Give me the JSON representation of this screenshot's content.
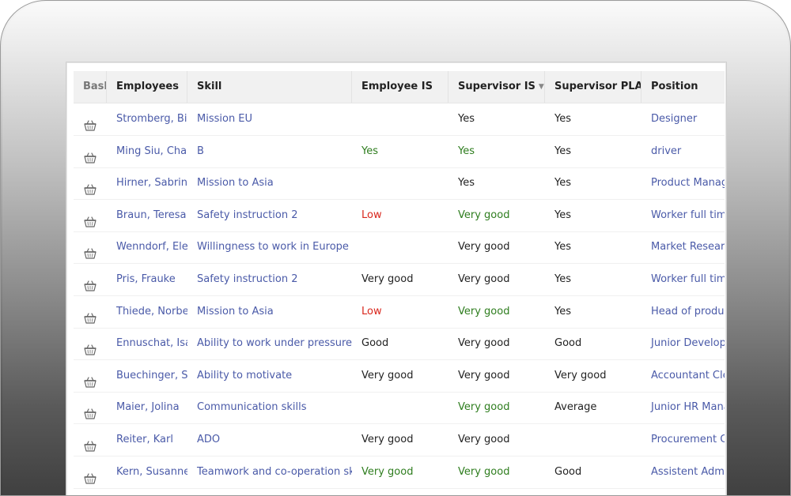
{
  "columns": {
    "basket": "Basket",
    "employees": "Employees",
    "skill": "Skill",
    "employee_is": "Employee IS",
    "supervisor_is": "Supervisor IS",
    "supervisor_plan": "Supervisor PLAN",
    "position": "Position"
  },
  "sort": {
    "column": "supervisor_is",
    "direction": "descending",
    "icon": "sort-down-triangle-icon"
  },
  "row_icon": "basket-icon",
  "colors": {
    "link": "#4a5aa8",
    "good": "#2e7d1e",
    "low": "#d9261c"
  },
  "rows": [
    {
      "employee": "Stromberg, Birgit",
      "skill": "Mission EU",
      "employee_is": "",
      "employee_is_tone": "",
      "supervisor_is": "Yes",
      "supervisor_is_tone": "",
      "supervisor_plan": "Yes",
      "position": "Designer"
    },
    {
      "employee": "Ming Siu, Chang",
      "skill": "B",
      "employee_is": "Yes",
      "employee_is_tone": "green",
      "supervisor_is": "Yes",
      "supervisor_is_tone": "green",
      "supervisor_plan": "Yes",
      "position": "driver"
    },
    {
      "employee": "Hirner, Sabrina",
      "skill": "Mission to Asia",
      "employee_is": "",
      "employee_is_tone": "",
      "supervisor_is": "Yes",
      "supervisor_is_tone": "",
      "supervisor_plan": "Yes",
      "position": "Product Manager"
    },
    {
      "employee": "Braun, Teresa",
      "skill": "Safety instruction 2",
      "employee_is": "Low",
      "employee_is_tone": "red",
      "supervisor_is": "Very good",
      "supervisor_is_tone": "green",
      "supervisor_plan": "Yes",
      "position": "Worker full time"
    },
    {
      "employee": "Wenndorf, Elena",
      "skill": "Willingness to work in Europe",
      "employee_is": "",
      "employee_is_tone": "",
      "supervisor_is": "Very good",
      "supervisor_is_tone": "",
      "supervisor_plan": "Yes",
      "position": "Market Research"
    },
    {
      "employee": "Pris, Frauke",
      "skill": "Safety instruction 2",
      "employee_is": "Very good",
      "employee_is_tone": "",
      "supervisor_is": "Very good",
      "supervisor_is_tone": "",
      "supervisor_plan": "Yes",
      "position": "Worker full time"
    },
    {
      "employee": "Thiede, Norbert",
      "skill": "Mission to Asia",
      "employee_is": "Low",
      "employee_is_tone": "red",
      "supervisor_is": "Very good",
      "supervisor_is_tone": "green",
      "supervisor_plan": "Yes",
      "position": "Head of product"
    },
    {
      "employee": "Ennuschat, Isa",
      "skill": "Ability to work under pressure",
      "employee_is": "Good",
      "employee_is_tone": "",
      "supervisor_is": "Very good",
      "supervisor_is_tone": "",
      "supervisor_plan": "Good",
      "position": "Junior Developer"
    },
    {
      "employee": "Buechinger, Stefan",
      "skill": "Ability to motivate",
      "employee_is": "Very good",
      "employee_is_tone": "",
      "supervisor_is": "Very good",
      "supervisor_is_tone": "",
      "supervisor_plan": "Very good",
      "position": "Accountant Clerk"
    },
    {
      "employee": "Maier, Jolina",
      "skill": "Communication skills",
      "employee_is": "",
      "employee_is_tone": "",
      "supervisor_is": "Very good",
      "supervisor_is_tone": "green",
      "supervisor_plan": "Average",
      "position": "Junior HR Manager"
    },
    {
      "employee": "Reiter, Karl",
      "skill": "ADO",
      "employee_is": "Very good",
      "employee_is_tone": "",
      "supervisor_is": "Very good",
      "supervisor_is_tone": "",
      "supervisor_plan": "",
      "position": "Procurement Clerk"
    },
    {
      "employee": "Kern, Susanne",
      "skill": "Teamwork and co-operation skills",
      "employee_is": "Very good",
      "employee_is_tone": "green",
      "supervisor_is": "Very good",
      "supervisor_is_tone": "green",
      "supervisor_plan": "Good",
      "position": "Assistent Administration"
    }
  ]
}
